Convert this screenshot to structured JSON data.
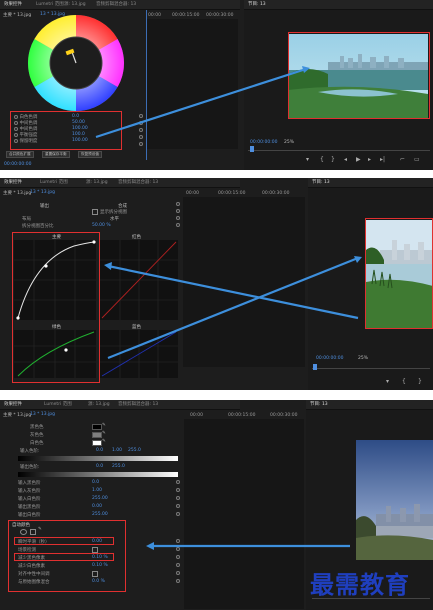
{
  "tabs": {
    "effect_controls": "效果控件",
    "lumetri_scopes": "Lumetri 范围",
    "source": "源: 13.jpg",
    "audio_mixer": "音频剪辑混合器: 13",
    "program": "节目: 13"
  },
  "clip": {
    "master": "主要 * 13.jpg",
    "seq": "13 * 13.jpg"
  },
  "ruler": [
    "00:00",
    "00:00:15:00",
    "00:00:30:00"
  ],
  "p1": {
    "params": [
      {
        "label": "白色色调",
        "value": "0.0"
      },
      {
        "label": "中间色调",
        "value": "50.00"
      },
      {
        "label": "中间色调",
        "value": "100.00"
      },
      {
        "label": "平衡强度",
        "value": "100.0"
      },
      {
        "label": "保留明度",
        "value": "100.00"
      }
    ],
    "buttons": [
      "合并颜色扩展",
      "重置保存平衡",
      "恢复预设值"
    ],
    "tc_left": "00:00:00:00",
    "tc_monitor": "00:00:00:00",
    "zoom": "25%"
  },
  "p2": {
    "header_prop": "输出",
    "header_value": "合成",
    "show_split": "显示拆分视图",
    "layout_label": "布局",
    "layout_value": "水平",
    "split_label": "拆分视图百分比",
    "split_value": "50.00 %",
    "curve_labels": [
      "主要",
      "红色",
      "绿色",
      "蓝色"
    ],
    "tc_monitor": "00:00:00:00",
    "zoom": "25%"
  },
  "p3": {
    "top_rows": [
      {
        "label": "黑色色",
        "value": ""
      },
      {
        "label": "灰色色",
        "value": ""
      },
      {
        "label": "白色色",
        "value": ""
      }
    ],
    "input_levels_label": "输入色阶:",
    "input_levels_values": [
      "0.0",
      "1.00",
      "255.0"
    ],
    "output_levels_label": "输出色阶:",
    "output_levels_values": [
      "0.0",
      "255.0"
    ],
    "levels_rows": [
      {
        "label": "输入黑色阶",
        "value": "0.0"
      },
      {
        "label": "输入灰色阶",
        "value": "1.00"
      },
      {
        "label": "输入白色阶",
        "value": "255.00"
      },
      {
        "label": "输出黑色阶",
        "value": "0.00"
      },
      {
        "label": "输出白色阶",
        "value": "255.00"
      }
    ],
    "auto_color": "自动颜色",
    "auto_rows": [
      {
        "label": "瞬时平滑（秒）",
        "value": "0.00"
      },
      {
        "label": "场景检测",
        "value": ""
      },
      {
        "label": "减少黑色像素",
        "value": "0.10 %"
      },
      {
        "label": "减少白色像素",
        "value": "0.10 %"
      },
      {
        "label": "对齐中性中间调",
        "value": ""
      },
      {
        "label": "与原始图像混合",
        "value": "0.0 %"
      }
    ]
  },
  "watermark": "最需教育"
}
